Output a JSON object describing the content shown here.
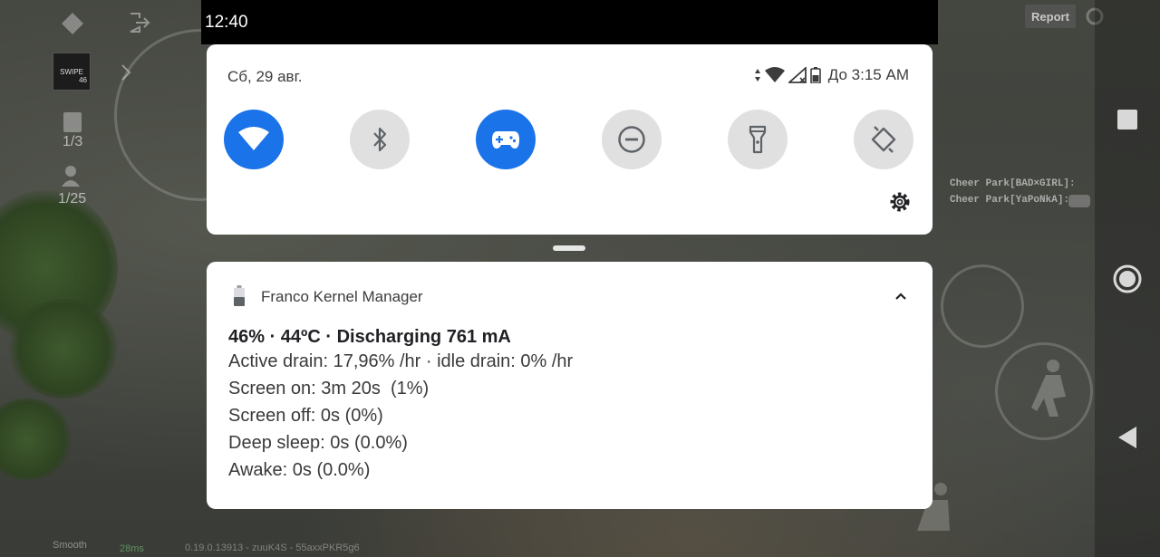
{
  "status_bar": {
    "time": "12:40"
  },
  "quick_settings": {
    "date": "Сб, 29 авг.",
    "battery_estimate": "До 3:15 AM",
    "tiles": [
      {
        "name": "wifi",
        "icon": "wifi-icon",
        "active": true
      },
      {
        "name": "bluetooth",
        "icon": "bluetooth-icon",
        "active": false
      },
      {
        "name": "game-mode",
        "icon": "gamepad-icon",
        "active": true
      },
      {
        "name": "do-not-disturb",
        "icon": "do-not-disturb-icon",
        "active": false
      },
      {
        "name": "flashlight",
        "icon": "flashlight-icon",
        "active": false
      },
      {
        "name": "auto-rotate",
        "icon": "auto-rotate-icon",
        "active": false
      }
    ],
    "accent_color": "#1a73e8"
  },
  "notification": {
    "app_name": "Franco Kernel Manager",
    "title": "46% · 44ºC · Discharging 761 mA",
    "lines": [
      "Active drain: 17,96% /hr · idle drain: 0% /hr",
      "Screen on: 3m 20s  (1%)",
      "Screen off: 0s (0%)",
      "Deep sleep: 0s (0.0%)",
      "Awake: 0s (0.0%)"
    ]
  },
  "game_hud": {
    "report_label": "Report",
    "counter_1": "1/3",
    "counter_2": "1/25",
    "swipe_badge": "SWIPE",
    "swipe_count": "46",
    "chat": [
      "Cheer Park[BAD×GIRL]:",
      "Cheer Park[YaPoNkA]:"
    ],
    "graphics": "Smooth",
    "ping": "28ms",
    "build_info": "0.19.0.13913 - zuuK4S - 55axxPKR5g6"
  }
}
